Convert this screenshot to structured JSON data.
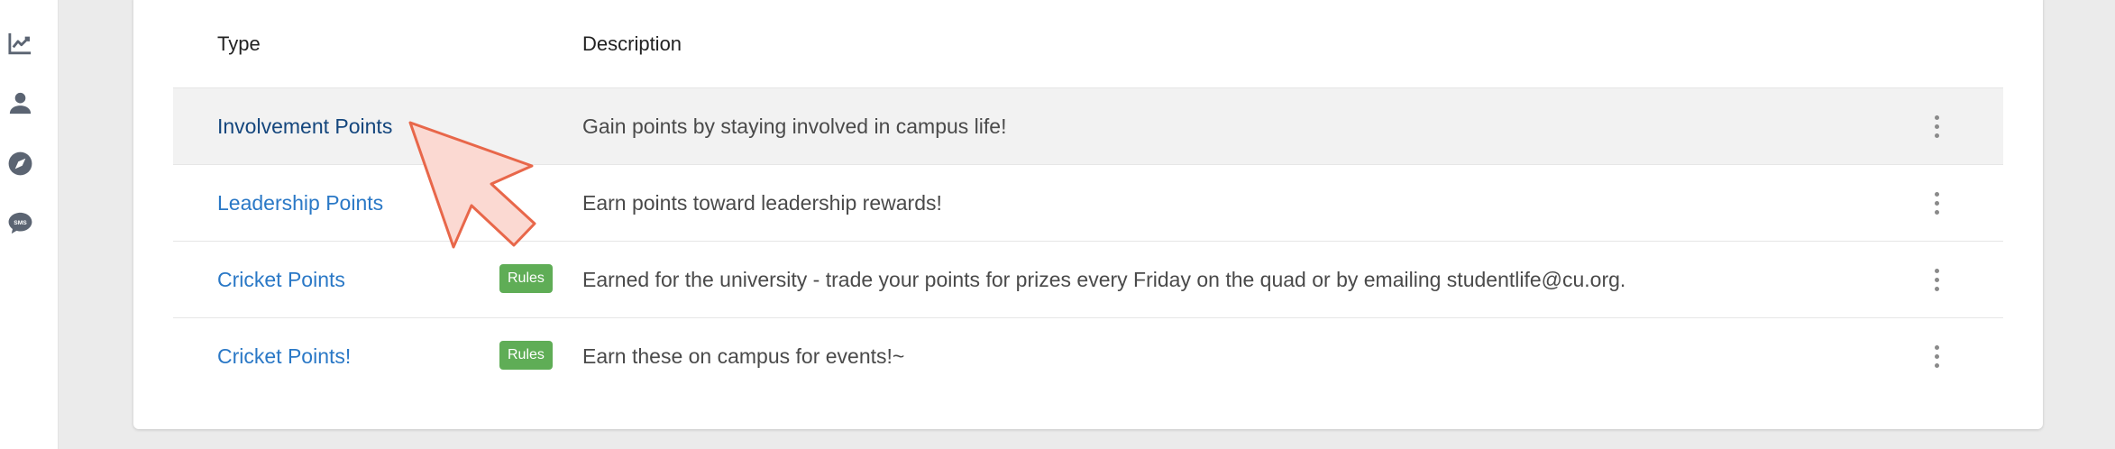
{
  "sidebar": {
    "items": [
      {
        "icon": "trending-chart-icon"
      },
      {
        "icon": "person-icon"
      },
      {
        "icon": "compass-icon"
      },
      {
        "icon": "sms-chat-icon",
        "glyph_text": "SMS"
      }
    ]
  },
  "table": {
    "headers": {
      "type": "Type",
      "description": "Description"
    },
    "rows": [
      {
        "type": "Involvement Points",
        "badge": "",
        "description": "Gain points by staying involved in campus life!",
        "highlighted": true
      },
      {
        "type": "Leadership Points",
        "badge": "",
        "description": "Earn points toward leadership rewards!",
        "highlighted": false
      },
      {
        "type": "Cricket Points",
        "badge": "Rules",
        "description": "Earned for the university - trade your points for prizes every Friday on the quad or by emailing studentlife@cu.org.",
        "highlighted": false
      },
      {
        "type": "Cricket Points!",
        "badge": "Rules",
        "description": "Earn these on campus for events!~",
        "highlighted": false
      }
    ]
  },
  "colors": {
    "link": "#2a78c6",
    "link_active": "#14467d",
    "badge": "#5fad56",
    "highlight_row": "#f2f2f2",
    "cursor_fill": "#fbd9d2",
    "cursor_stroke": "#e8674a"
  }
}
